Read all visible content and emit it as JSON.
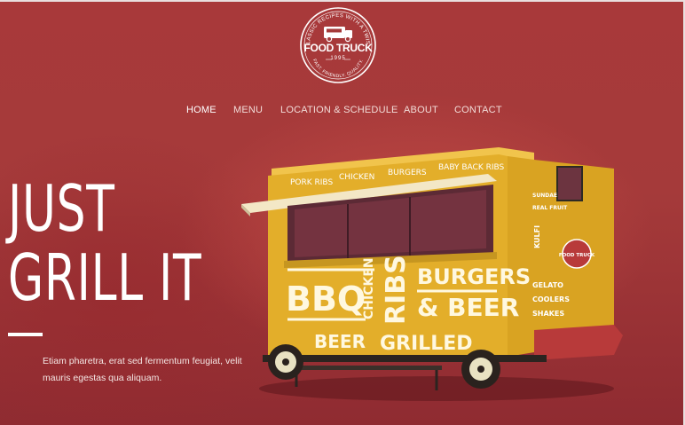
{
  "logo": {
    "arc_top": "CLASSIC RECIPES WITH A TWIST",
    "title": "FOOD TRUCK",
    "year": "1995",
    "arc_bottom": "FAST. FRIENDLY. QUALITY."
  },
  "nav": {
    "items": [
      {
        "label": "HOME",
        "active": true
      },
      {
        "label": "MENU",
        "active": false
      },
      {
        "label": "LOCATION & SCHEDULE",
        "active": false
      },
      {
        "label": "ABOUT",
        "active": false
      },
      {
        "label": "CONTACT",
        "active": false
      }
    ]
  },
  "hero": {
    "headline_line1": "JUST",
    "headline_line2": "GRILL IT",
    "description": "Etiam pharetra, erat sed fermentum feugiat, velit mauris egestas qua aliquam."
  },
  "truck": {
    "awning_text": [
      "PORK RIBS",
      "CHICKEN",
      "BURGERS",
      "BABY BACK RIBS"
    ],
    "side_text": {
      "bbq": "BBQ",
      "chicken": "CHICKEN",
      "ribs": "RIBS",
      "burgers": "BURGERS",
      "and_beer": "& BEER",
      "beer": "BEER",
      "grilled": "GRILLED"
    },
    "rear_text": [
      "KULFI",
      "GELATO",
      "COOLERS",
      "SHAKES",
      "REAL FRUIT",
      "SUNDAE"
    ],
    "rear_badge": "FOOD TRUCK"
  },
  "colors": {
    "background": "#a53a3a",
    "truck_yellow": "#e3ae2a",
    "truck_red": "#b83a3a",
    "text_white": "#ffffff"
  }
}
